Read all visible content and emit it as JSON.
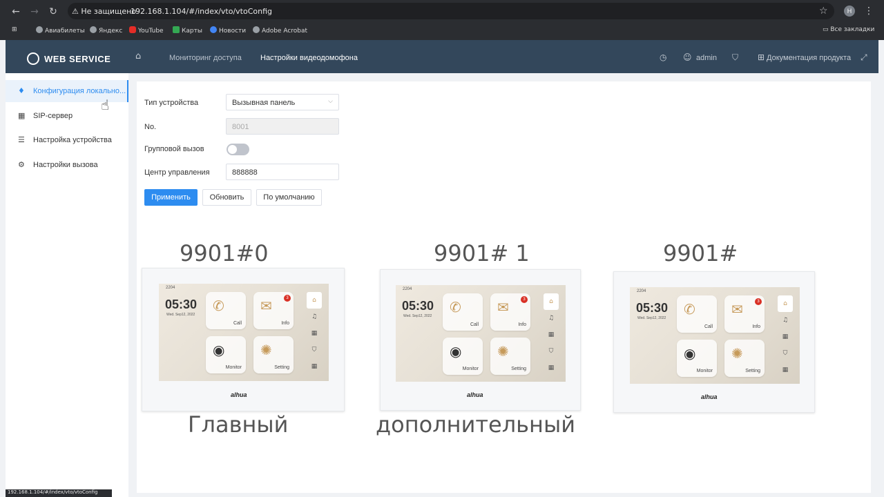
{
  "browser": {
    "insecure_label": "⚠ Не защищено",
    "url": "192.168.1.104/#/index/vto/vtoConfig",
    "profile_initial": "H",
    "bookmarks": [
      "Авиабилеты",
      "Яндекс",
      "YouTube",
      "Карты",
      "Новости",
      "Adobe Acrobat"
    ],
    "all_bookmarks": "Все закладки",
    "status_url": "192.168.1.104/#/index/vto/vtoConfig"
  },
  "header": {
    "logo": "WEB SERVICE",
    "nav": [
      "Мониторинг доступа",
      "Настройки видеодомофона"
    ],
    "user": "admin",
    "docs": "Документация продукта"
  },
  "sidebar": {
    "items": [
      {
        "label": "Конфигурация локально...",
        "icon": "mic-icon"
      },
      {
        "label": "SIP-сервер",
        "icon": "server-icon"
      },
      {
        "label": "Настройка устройства",
        "icon": "device-settings-icon"
      },
      {
        "label": "Настройки вызова",
        "icon": "call-settings-icon"
      }
    ]
  },
  "form": {
    "device_type_label": "Тип устройства",
    "device_type_value": "Вызывная панель",
    "no_label": "No.",
    "no_placeholder": "8001",
    "group_call_label": "Групповой вызов",
    "control_center_label": "Центр управления",
    "control_center_value": "888888",
    "apply": "Применить",
    "refresh": "Обновить",
    "default": "По умолчанию"
  },
  "monitors": [
    {
      "code": "9901#0",
      "caption": "Главный"
    },
    {
      "code": "9901# 1",
      "caption": "дополнительный"
    },
    {
      "code": "9901#",
      "caption": ""
    }
  ],
  "screen": {
    "num": "2204",
    "time": "05:30",
    "date": "Wed. Sep12, 2022",
    "call": "Call",
    "info": "Info",
    "monitor": "Monitor",
    "setting": "Setting",
    "badge": "3",
    "brand": "alhua"
  },
  "colors": {
    "accent": "#2d8cf0",
    "header_bg": "#33475b",
    "browser_bg": "#2b2d31"
  }
}
